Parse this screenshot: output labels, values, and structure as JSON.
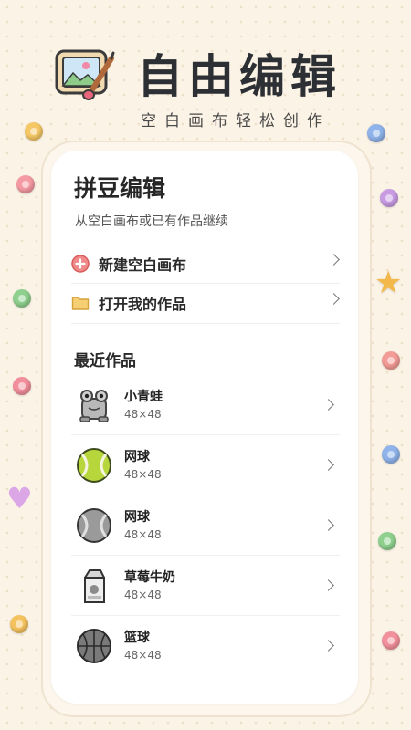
{
  "header": {
    "title": "自由编辑",
    "subtitle": "空白画布轻松创作"
  },
  "card": {
    "title": "拼豆编辑",
    "description": "从空白画布或已有作品继续",
    "actions": [
      {
        "label": "新建空白画布",
        "icon": "plus-circle-icon"
      },
      {
        "label": "打开我的作品",
        "icon": "folder-icon"
      }
    ],
    "recent_title": "最近作品",
    "recent": [
      {
        "name": "小青蛙",
        "size": "48×48",
        "icon": "frog-icon"
      },
      {
        "name": "网球",
        "size": "48×48",
        "icon": "tennis-ball-icon"
      },
      {
        "name": "网球",
        "size": "48×48",
        "icon": "gray-ball-icon"
      },
      {
        "name": "草莓牛奶",
        "size": "48×48",
        "icon": "milk-carton-icon"
      },
      {
        "name": "篮球",
        "size": "48×48",
        "icon": "basketball-icon"
      }
    ]
  },
  "colors": {
    "background": "#fbf3e6",
    "accent_red": "#e25b5b",
    "folder": "#f3c96a"
  }
}
